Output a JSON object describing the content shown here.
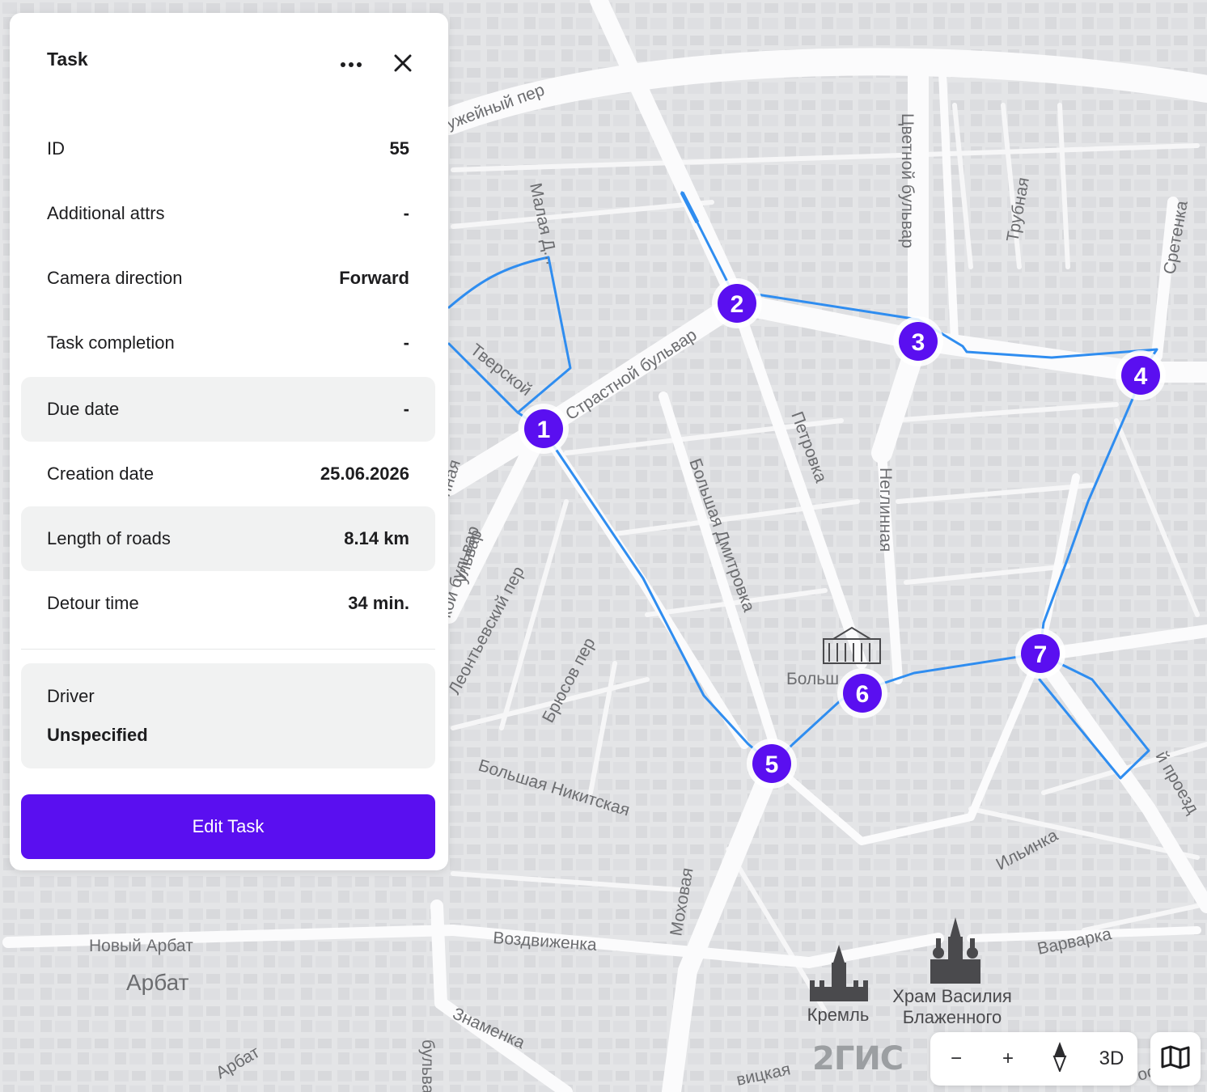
{
  "panel": {
    "title": "Task",
    "more_icon": "more-horizontal-icon",
    "close_icon": "close-icon",
    "rows": [
      {
        "label": "ID",
        "value": "55"
      },
      {
        "label": "Additional attrs",
        "value": "-"
      },
      {
        "label": "Camera direction",
        "value": "Forward"
      },
      {
        "label": "Task completion",
        "value": "-"
      },
      {
        "label": "Due date",
        "value": "-"
      },
      {
        "label": "Creation date",
        "value": "25.06.2026"
      },
      {
        "label": "Length of roads",
        "value": "8.14 km"
      },
      {
        "label": "Detour time",
        "value": "34 min."
      }
    ],
    "driver": {
      "label": "Driver",
      "value": "Unspecified"
    },
    "edit_button": "Edit Task"
  },
  "map": {
    "route_color": "#2f8df0",
    "marker_color": "#5a0ff0",
    "markers": [
      "1",
      "2",
      "3",
      "4",
      "5",
      "6",
      "7"
    ],
    "street_labels": [
      "Страстной бульвар",
      "Петровка",
      "Большая Дмитровка",
      "Неглинная",
      "Цветной бульвар",
      "Трубная",
      "Сретенка",
      "Малая Д...",
      "ужейный пер",
      "Леонтьевский пер",
      "Брюсов пер",
      "Большая Никитская",
      "Моховая",
      "Воздвиженка",
      "Новый Арбат",
      "Арбат",
      "Арбат",
      "Знаменка",
      "Ильинка",
      "Варварка",
      "й проезд",
      "кой бульвар",
      "ульвар",
      "нная",
      "вицкая",
      "Тверской",
      "Больш",
      "осква",
      "бульвар"
    ],
    "poi": [
      {
        "name": "Кремль",
        "icon": "kremlin-icon"
      },
      {
        "name": "Храм Василия Блаженного",
        "icon": "cathedral-icon"
      },
      {
        "name": "Больш",
        "icon": "theatre-icon"
      }
    ]
  },
  "controls": {
    "logo": "2ГИС",
    "zoom_out": "−",
    "zoom_in": "+",
    "compass_icon": "compass-icon",
    "mode_3d": "3D",
    "layers_icon": "map-layers-icon"
  }
}
